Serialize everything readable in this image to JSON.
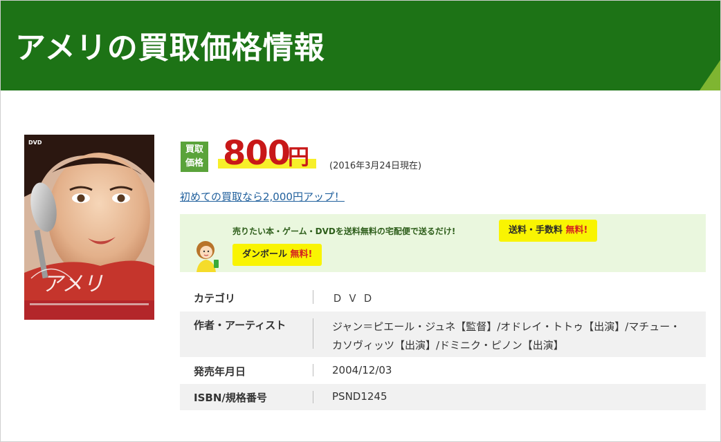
{
  "header": {
    "title": "アメリの買取価格情報"
  },
  "product": {
    "cover": {
      "logo_text": "DVD",
      "title_script": "アメリ"
    }
  },
  "price": {
    "badge_line1": "買取",
    "badge_line2": "価格",
    "value": "800",
    "unit": "円",
    "date": "(2016年3月24日現在)"
  },
  "promo": {
    "link_text": "初めての買取なら2,000円アップ！"
  },
  "shipping": {
    "message": "売りたい本・ゲーム・DVDを送料無料の宅配便で送るだけ!",
    "fee_label": "送料・手数料",
    "fee_free": "無料!",
    "box_label": "ダンボール",
    "box_free": "無料!"
  },
  "details": {
    "rows": [
      {
        "label": "カテゴリ",
        "value": "ＤＶＤ"
      },
      {
        "label": "作者・アーティスト",
        "value": "ジャン＝ピエール・ジュネ【監督】/オドレイ・トトゥ【出演】/マチュー・カソヴィッツ【出演】/ドミニク・ピノン【出演】"
      },
      {
        "label": "発売年月日",
        "value": "2004/12/03"
      },
      {
        "label": "ISBN/規格番号",
        "value": "PSND1245"
      }
    ]
  },
  "colors": {
    "header_bg": "#1d7316",
    "accent_green": "#7fb531",
    "price_red": "#c81818",
    "badge_green": "#5aa33a",
    "highlight_yellow": "#f9f402",
    "banner_bg": "#eaf7de"
  }
}
